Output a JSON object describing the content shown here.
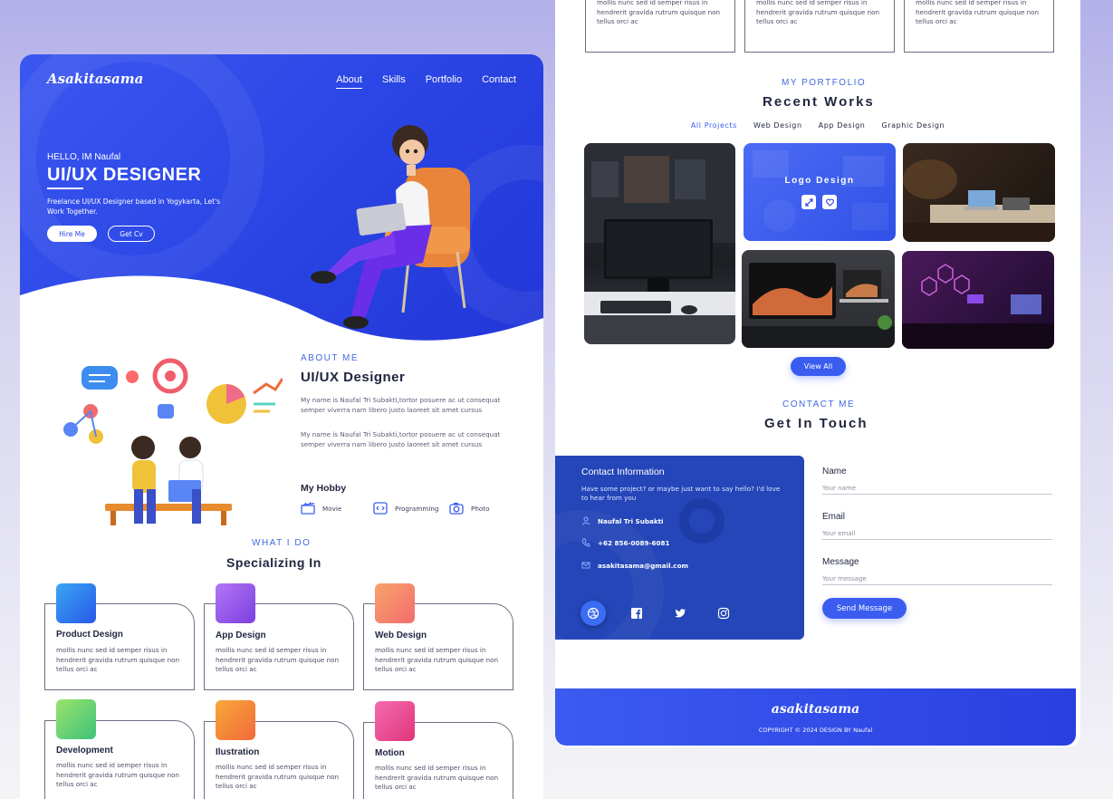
{
  "brand": {
    "logo": "Asakitasama",
    "footer_logo": "asakitasama",
    "accent": "#3a5df0",
    "hero_bg": "#2b47e6",
    "contact_bg": "#2446b8"
  },
  "nav": {
    "items": [
      "About",
      "Skills",
      "Portfolio",
      "Contact"
    ],
    "active": "About"
  },
  "hero": {
    "greeting": "HELLO, IM Naufal",
    "role": "UI/UX DESIGNER",
    "tagline": "Freelance UI/UX Designer based in Yogykarta, Let's Work Together.",
    "hire_label": "Hire Me",
    "cv_label": "Get Cv"
  },
  "about": {
    "kicker": "ABOUT ME",
    "title": "UI/UX Designer",
    "para1": "My name is Naufal Tri Subakti,tortor posuere ac ut consequat semper viverra nam libero justo laoreet sit amet cursus",
    "para2": "My name is Naufal Tri Subakti,tortor posuere ac ut consequat semper viverra nam libero justo laoreet sit amet cursus",
    "hobby_title": "My Hobby",
    "hobbies": [
      {
        "label": "Movie",
        "icon": "clapperboard-icon"
      },
      {
        "label": "Programming",
        "icon": "code-icon"
      },
      {
        "label": "Photo",
        "icon": "camera-icon"
      }
    ]
  },
  "services": {
    "kicker": "WHAT I DO",
    "title": "Specializing In",
    "items": [
      {
        "title": "Product Design",
        "desc": "mollis nunc sed id semper risus in hendrerit gravida rutrum quisque non tellus orci ac",
        "icon": "product-design-icon"
      },
      {
        "title": "App Design",
        "desc": "mollis nunc sed id semper risus in hendrerit gravida rutrum quisque non tellus orci ac",
        "icon": "app-design-icon"
      },
      {
        "title": "Web Design",
        "desc": "mollis nunc sed id semper risus in hendrerit gravida rutrum quisque non tellus orci ac",
        "icon": "web-design-icon"
      },
      {
        "title": "Development",
        "desc": "mollis nunc sed id semper risus in hendrerit gravida rutrum quisque non tellus orci ac",
        "icon": "development-icon"
      },
      {
        "title": "Ilustration",
        "desc": "mollis nunc sed id semper risus in hendrerit gravida rutrum quisque non tellus orci ac",
        "icon": "illustration-icon"
      },
      {
        "title": "Motion",
        "desc": "mollis nunc sed id semper risus in hendrerit gravida rutrum quisque non tellus orci ac",
        "icon": "motion-icon"
      }
    ]
  },
  "portfolio": {
    "kicker": "MY PORTFOLIO",
    "title": "Recent Works",
    "filters": [
      "All Projects",
      "Web Design",
      "App Design",
      "Graphic Design"
    ],
    "active_filter": "All Projects",
    "hover_title": "Logo Design",
    "view_all": "View All"
  },
  "contact": {
    "kicker": "CONTACT ME",
    "title": "Get In Touch",
    "card_title": "Contact Information",
    "card_sub": "Have some project? or maybe just want to say hello? I'd love to hear from you",
    "name": "Naufal Tri Subakti",
    "phone": "+62 856-0089-6081",
    "email": "asakitasama@gmail.com",
    "form": {
      "name_label": "Name",
      "name_placeholder": "Your name",
      "email_label": "Email",
      "email_placeholder": "Your email",
      "message_label": "Message",
      "message_placeholder": "Your message",
      "send_label": "Send Message"
    }
  },
  "footer": {
    "copyright": "COPYRIGHT © 2024 DESIGN BY Naufal"
  }
}
